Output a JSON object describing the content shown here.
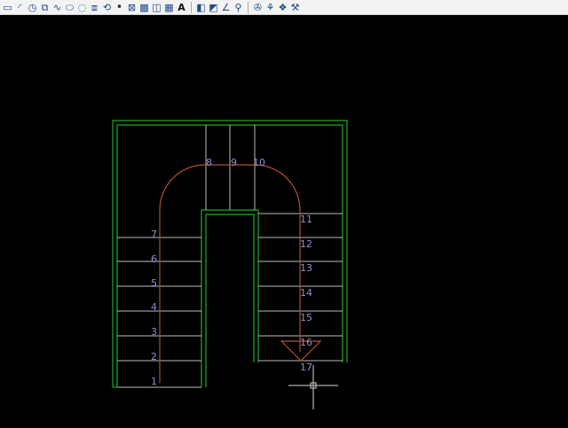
{
  "toolbar": {
    "group1": [
      {
        "name": "rectangle-tool-icon",
        "glyph": "▭"
      },
      {
        "name": "arc-tool-icon",
        "glyph": "◜"
      },
      {
        "name": "circle-tool-icon",
        "glyph": "◷"
      },
      {
        "name": "revision-cloud-tool-icon",
        "glyph": "⧉"
      },
      {
        "name": "spline-tool-icon",
        "glyph": "∿"
      },
      {
        "name": "ellipse-tool-icon",
        "glyph": "⬭"
      },
      {
        "name": "ellipse-arc-tool-icon",
        "glyph": "◌"
      },
      {
        "name": "insert-block-tool-icon",
        "glyph": "⧈"
      },
      {
        "name": "make-block-tool-icon",
        "glyph": "⟲"
      },
      {
        "name": "point-tool-icon",
        "glyph": "•"
      },
      {
        "name": "hatch-tool-icon",
        "glyph": "⊠"
      },
      {
        "name": "gradient-tool-icon",
        "glyph": "▩"
      },
      {
        "name": "region-tool-icon",
        "glyph": "◫"
      },
      {
        "name": "table-tool-icon",
        "glyph": "▦"
      },
      {
        "name": "text-tool-icon",
        "glyph": "A"
      }
    ],
    "group2": [
      {
        "name": "layer-tool-icon",
        "glyph": "◧"
      },
      {
        "name": "properties-tool-icon",
        "glyph": "◩"
      },
      {
        "name": "angle-tool-icon",
        "glyph": "∠"
      },
      {
        "name": "match-properties-tool-icon",
        "glyph": "⚲"
      }
    ],
    "group3": [
      {
        "name": "layer-state-tool-icon",
        "glyph": "✇"
      },
      {
        "name": "layer-isolate-tool-icon",
        "glyph": "⚘"
      },
      {
        "name": "layer-freeze-tool-icon",
        "glyph": "❖"
      },
      {
        "name": "layer-off-tool-icon",
        "glyph": "⚒"
      }
    ]
  },
  "drawing": {
    "step_numbers": [
      "1",
      "2",
      "3",
      "4",
      "5",
      "6",
      "7",
      "8",
      "9",
      "10",
      "11",
      "12",
      "13",
      "14",
      "15",
      "16",
      "17"
    ],
    "colors": {
      "wall": "#1fae1f",
      "tread": "#bdbdbd",
      "walk_line": "#b0522a",
      "step_number": "#8a90d6",
      "cursor": "#d8d8d8"
    }
  }
}
